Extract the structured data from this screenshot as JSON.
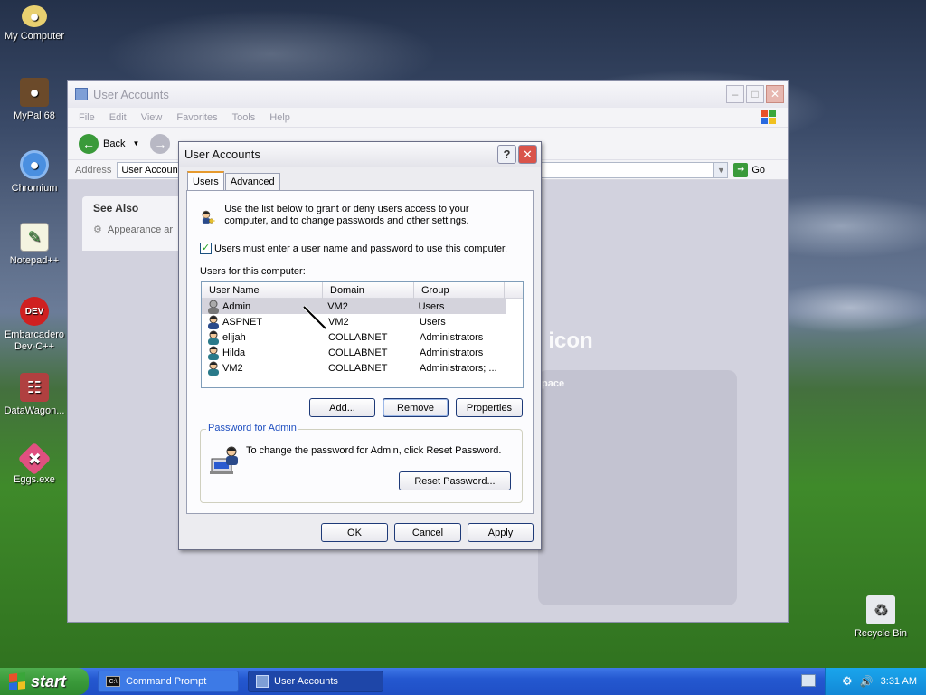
{
  "desktop": {
    "icons": [
      {
        "label": "My Computer"
      },
      {
        "label": "MyPal 68"
      },
      {
        "label": "Chromium"
      },
      {
        "label": "Notepad++"
      },
      {
        "label": "Embarcadero Dev-C++"
      },
      {
        "label": "DataWagon..."
      },
      {
        "label": "Eggs.exe"
      },
      {
        "label": "Recycle Bin"
      }
    ]
  },
  "explorer": {
    "title": "User Accounts",
    "menu": [
      "File",
      "Edit",
      "View",
      "Favorites",
      "Tools",
      "Help"
    ],
    "back_label": "Back",
    "address_label": "Address",
    "address_value": "User Accounts",
    "go_label": "Go",
    "see_also_title": "See Also",
    "see_also_item": "Appearance ar",
    "bg_text_1": "l icon",
    "bg_text_2": "pace"
  },
  "dialog": {
    "title": "User Accounts",
    "tabs": [
      {
        "label": "Users",
        "active": true
      },
      {
        "label": "Advanced",
        "active": false
      }
    ],
    "intro": "Use the list below to grant or deny users access to your computer, and to change passwords and other settings.",
    "checkbox_label": "Users must enter a user name and password to use this computer.",
    "checkbox_checked": true,
    "users_label": "Users for this computer:",
    "columns": [
      "User Name",
      "Domain",
      "Group"
    ],
    "users": [
      {
        "name": "Admin",
        "domain": "VM2",
        "group": "Users",
        "selected": true
      },
      {
        "name": "ASPNET",
        "domain": "VM2",
        "group": "Users",
        "selected": false
      },
      {
        "name": "elijah",
        "domain": "COLLABNET",
        "group": "Administrators",
        "selected": false
      },
      {
        "name": "Hilda",
        "domain": "COLLABNET",
        "group": "Administrators",
        "selected": false
      },
      {
        "name": "VM2",
        "domain": "COLLABNET",
        "group": "Administrators; ...",
        "selected": false
      }
    ],
    "add_label": "Add...",
    "remove_label": "Remove",
    "properties_label": "Properties",
    "password_group_title": "Password for Admin",
    "password_msg": "To change the password for Admin, click Reset Password.",
    "reset_label": "Reset Password...",
    "ok_label": "OK",
    "cancel_label": "Cancel",
    "apply_label": "Apply"
  },
  "taskbar": {
    "start_label": "start",
    "items": [
      {
        "label": "Command Prompt",
        "active": false
      },
      {
        "label": "User Accounts",
        "active": true
      }
    ],
    "clock": "3:31 AM"
  },
  "colors": {
    "xp_blue": "#2458d0",
    "start_green": "#3a9a3a",
    "tab_accent": "#e69a2e",
    "close_red": "#d9534a"
  }
}
